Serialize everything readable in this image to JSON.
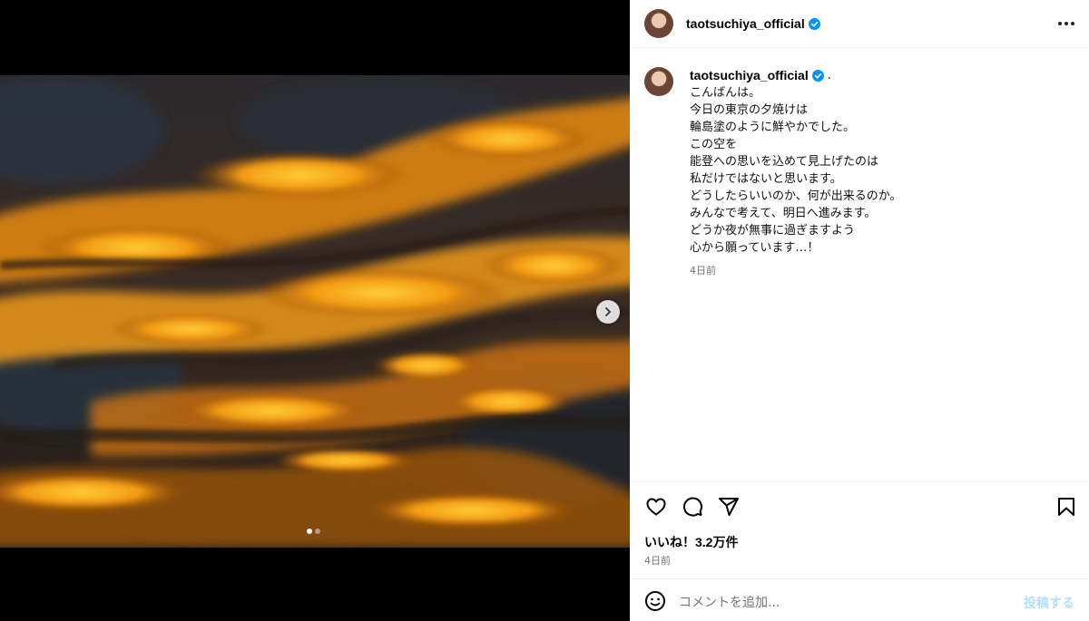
{
  "post": {
    "username": "taotsuchiya_official",
    "verified": true,
    "caption_trailing": ".",
    "caption_lines": [
      "こんばんは。",
      "今日の東京の夕焼けは",
      "輪島塗のように鮮やかでした。",
      "この空を",
      "能登への思いを込めて見上げたのは",
      "私だけではないと思います。",
      "どうしたらいいのか、何が出来るのか。",
      "みんなで考えて、明日へ進みます。",
      "どうか夜が無事に過ぎますよう",
      "心から願っています…！"
    ],
    "caption_time": "4日前",
    "likes": "いいね！3.2万件",
    "post_time": "4日前",
    "carousel": {
      "count": 2,
      "active": 0
    }
  },
  "comment_box": {
    "placeholder": "コメントを追加...",
    "submit_label": "投稿する"
  },
  "icons": {
    "header_more": "more-horizontal-icon",
    "like": "heart-icon",
    "comment": "comment-icon",
    "share": "paper-plane-icon",
    "save": "bookmark-icon",
    "emoji": "smiley-icon",
    "verified": "verified-badge-icon",
    "next": "chevron-right-icon"
  },
  "colors": {
    "verified_blue": "#0095f6",
    "submit_disabled": "#b2dffc",
    "secondary_text": "#737373"
  }
}
